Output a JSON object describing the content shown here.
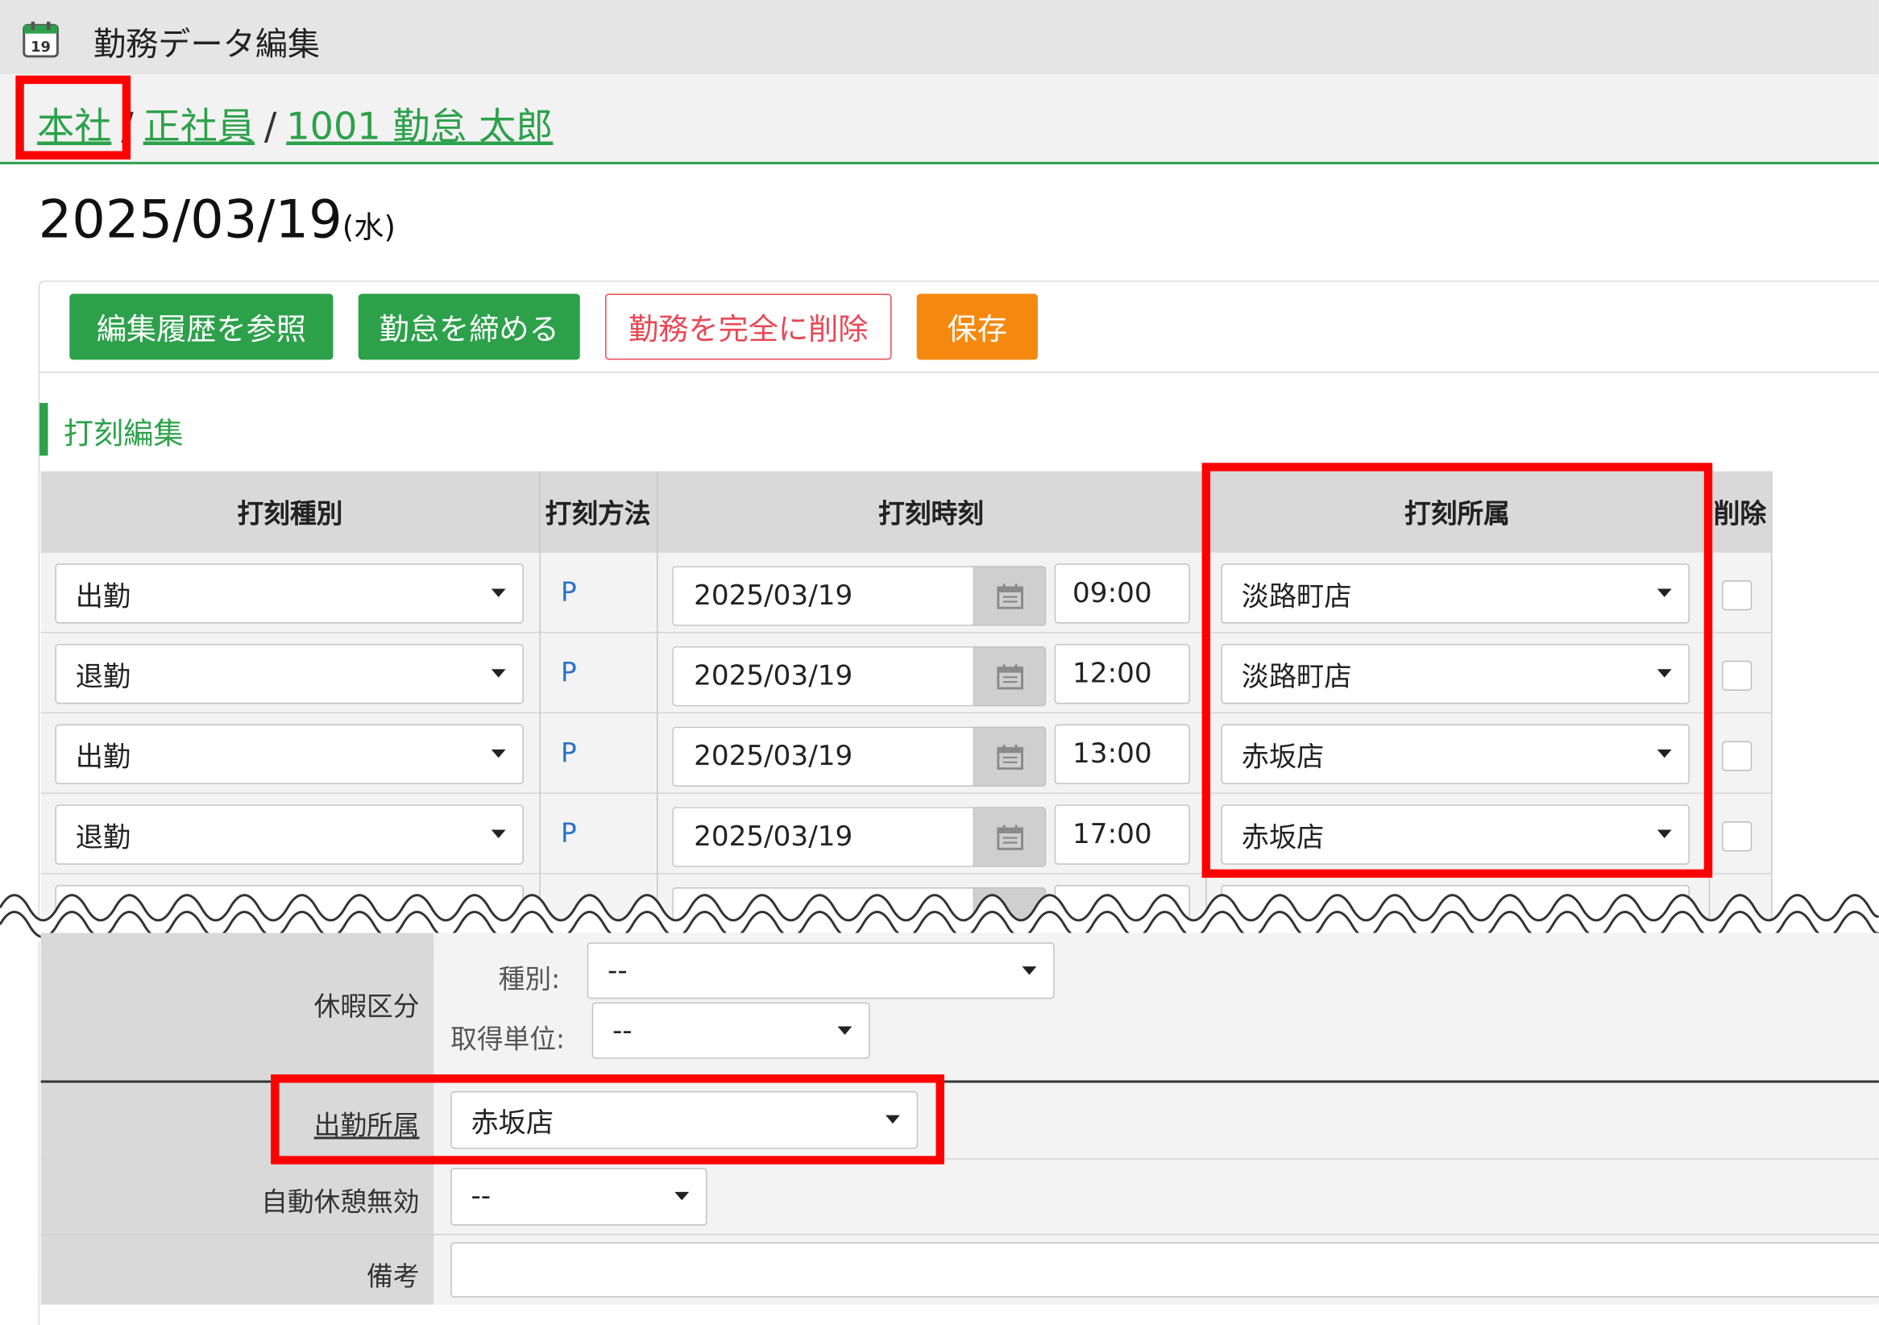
{
  "window": {
    "title": "勤務データ編集",
    "icon": "calendar-icon"
  },
  "breadcrumb": {
    "company": "本社",
    "employment_type": "正社員",
    "employee": "1001 勤怠 太郎",
    "separator": "/"
  },
  "date": {
    "value": "2025/03/19",
    "weekday": "(水)"
  },
  "toolbar": {
    "history_label": "編集履歴を参照",
    "close_label": "勤怠を締める",
    "delete_label": "勤務を完全に削除",
    "save_label": "保存"
  },
  "stamp_section": {
    "title": "打刻編集",
    "columns": [
      "打刻種別",
      "打刻方法",
      "打刻時刻",
      "打刻所属",
      "削除"
    ],
    "rows": [
      {
        "type": "出勤",
        "method": "P",
        "date": "2025/03/19",
        "time": "09:00",
        "affiliation": "淡路町店"
      },
      {
        "type": "退勤",
        "method": "P",
        "date": "2025/03/19",
        "time": "12:00",
        "affiliation": "淡路町店"
      },
      {
        "type": "出勤",
        "method": "P",
        "date": "2025/03/19",
        "time": "13:00",
        "affiliation": "赤坂店"
      },
      {
        "type": "退勤",
        "method": "P",
        "date": "2025/03/19",
        "time": "17:00",
        "affiliation": "赤坂店"
      }
    ]
  },
  "form": {
    "leave": {
      "label": "休暇区分",
      "type_label": "種別:",
      "type_value": "--",
      "unit_label": "取得単位:",
      "unit_value": "--"
    },
    "work_affiliation": {
      "label": "出勤所属",
      "value": "赤坂店"
    },
    "auto_break": {
      "label": "自動休憩無効",
      "value": "--"
    },
    "remarks": {
      "label": "備考",
      "value": ""
    }
  },
  "colors": {
    "accent_green": "#2ca14a",
    "save_orange": "#f5890f",
    "danger_red": "#e84855",
    "highlight_red": "#ff0000"
  }
}
